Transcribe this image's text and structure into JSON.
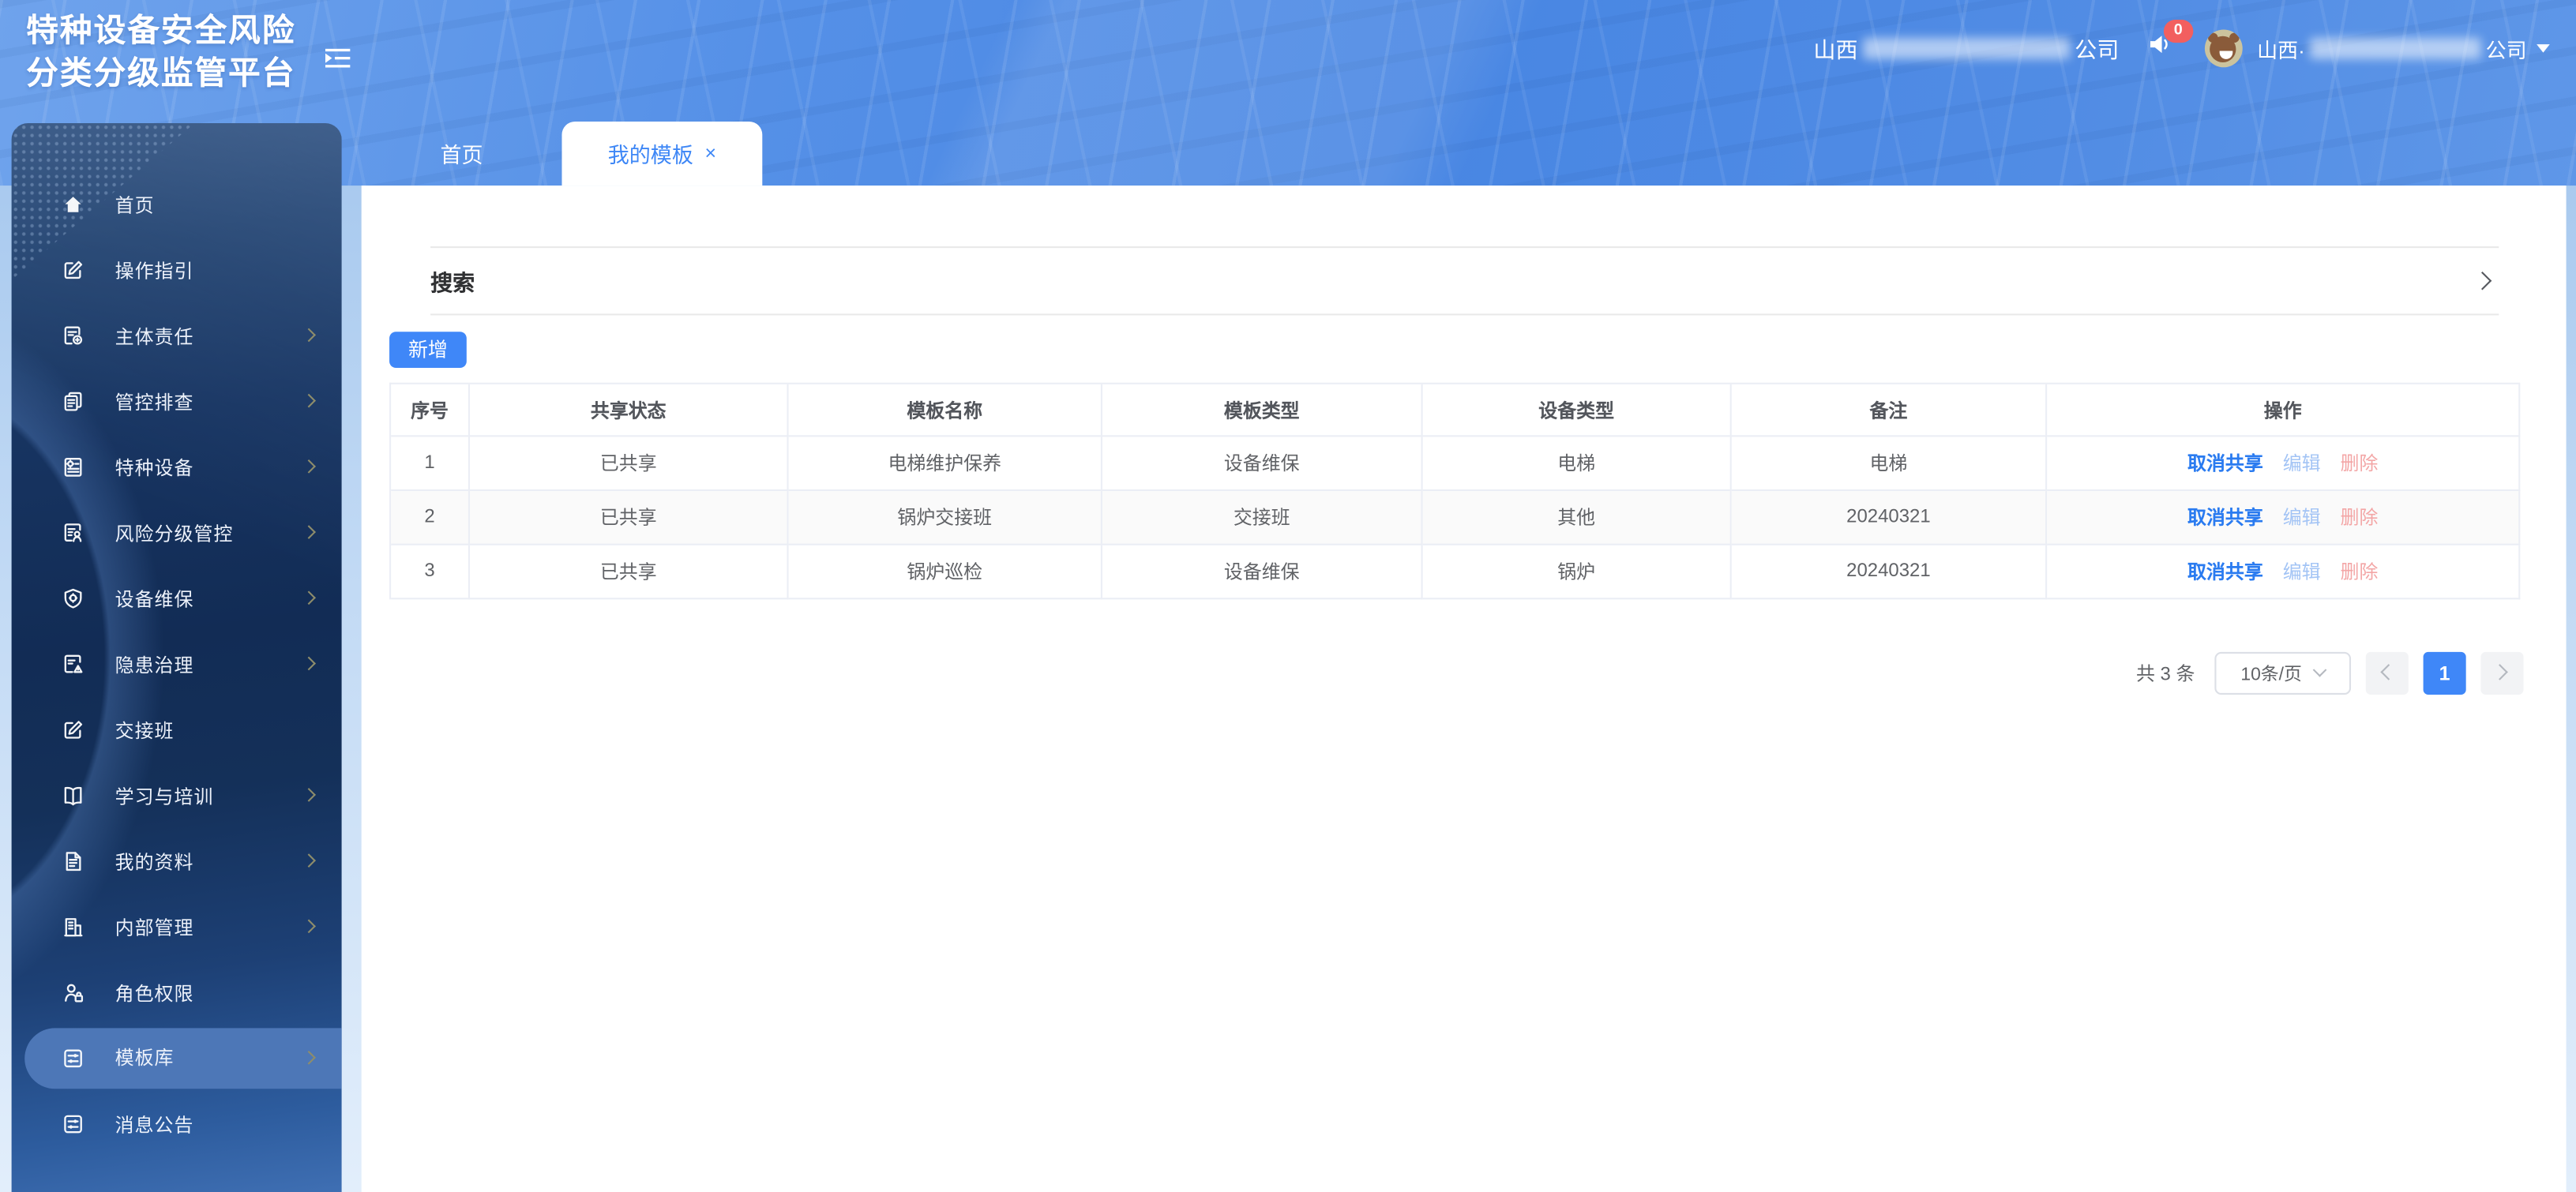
{
  "app": {
    "title_line1": "特种设备安全风险",
    "title_line2": "分类分级监管平台"
  },
  "header": {
    "company_prefix": "山西",
    "company_suffix": "公司",
    "notification_count": "0",
    "user_prefix": "山西·",
    "user_suffix": "公司"
  },
  "tabs": [
    {
      "label": "首页"
    },
    {
      "label": "我的模板",
      "close": "×"
    }
  ],
  "sidebar": {
    "items": [
      {
        "label": "首页"
      },
      {
        "label": "操作指引"
      },
      {
        "label": "主体责任"
      },
      {
        "label": "管控排查"
      },
      {
        "label": "特种设备"
      },
      {
        "label": "风险分级管控"
      },
      {
        "label": "设备维保"
      },
      {
        "label": "隐患治理"
      },
      {
        "label": "交接班"
      },
      {
        "label": "学习与培训"
      },
      {
        "label": "我的资料"
      },
      {
        "label": "内部管理"
      },
      {
        "label": "角色权限"
      },
      {
        "label": "模板库"
      },
      {
        "label": "消息公告"
      }
    ]
  },
  "search": {
    "label": "搜索"
  },
  "toolbar": {
    "add_label": "新增"
  },
  "table": {
    "columns": [
      "序号",
      "共享状态",
      "模板名称",
      "模板类型",
      "设备类型",
      "备注",
      "操作"
    ],
    "rows": [
      {
        "no": "1",
        "status": "已共享",
        "name": "电梯维护保养",
        "type": "设备维保",
        "device": "电梯",
        "remark": "电梯"
      },
      {
        "no": "2",
        "status": "已共享",
        "name": "锅炉交接班",
        "type": "交接班",
        "device": "其他",
        "remark": "20240321"
      },
      {
        "no": "3",
        "status": "已共享",
        "name": "锅炉巡检",
        "type": "设备维保",
        "device": "锅炉",
        "remark": "20240321"
      }
    ],
    "actions": {
      "cancel_share": "取消共享",
      "edit": "编辑",
      "delete": "删除"
    }
  },
  "pagination": {
    "total": "共 3 条",
    "page_size": "10条/页",
    "page": "1"
  },
  "icons": {
    "collapse": "indent-collapse-icon",
    "notification": "speaker-icon",
    "dropdown": "caret-down-icon",
    "search_expand": "chevron-right-icon",
    "menu": [
      "home-icon",
      "edit-square-icon",
      "doc-stamp-icon",
      "pages-icon",
      "doc-gear-icon",
      "doc-person-icon",
      "shield-gear-icon",
      "doc-warning-icon",
      "edit-square-icon",
      "book-icon",
      "doc-lines-icon",
      "building-icon",
      "person-lock-icon",
      "sliders-icon",
      "sliders-icon"
    ]
  },
  "colors": {
    "accent": "#3f87f8",
    "header_blue": "#4e8ae2",
    "sidebar_selected": "#4d77b7",
    "link_primary": "#2a7bf0",
    "link_edit_light": "#a3c4f5",
    "link_delete_light": "#f3a6a6",
    "badge_red": "#f25f5f",
    "pager_active": "#3f87f8"
  }
}
